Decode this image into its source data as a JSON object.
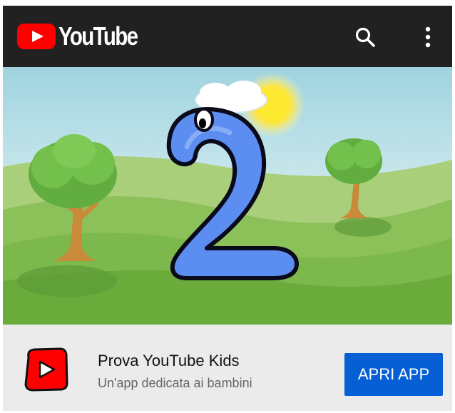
{
  "header": {
    "logo_text": "YouTube",
    "search_icon": "search-icon",
    "menu_icon": "more-vert-icon"
  },
  "video": {
    "thumbnail_subject": "2"
  },
  "promo": {
    "title": "Prova YouTube Kids",
    "subtitle": "Un'app dedicata ai bambini",
    "button_label": "APRI APP",
    "app_icon": "youtube-kids-logo-icon"
  },
  "colors": {
    "topbar": "#212121",
    "brand_red": "#ff0000",
    "button_blue": "#065fd4",
    "promo_bg": "#ebebeb"
  }
}
